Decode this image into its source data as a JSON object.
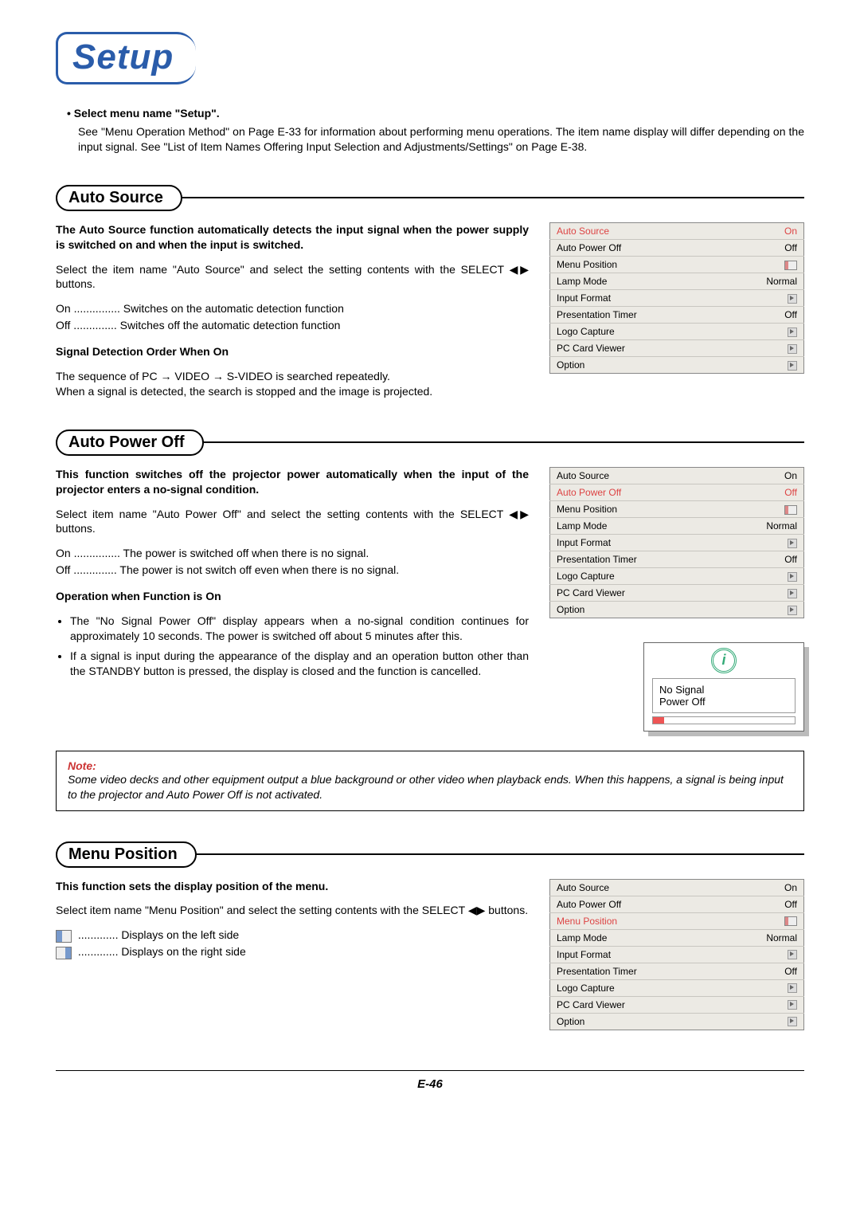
{
  "title": "Setup",
  "intro": {
    "bullet": "• Select menu name \"Setup\".",
    "text": "See \"Menu Operation Method\" on Page E-33 for information about performing menu operations. The item name display will differ depending on the input signal. See \"List of Item Names Offering Input Selection and Adjustments/Settings\" on Page E-38."
  },
  "sections": {
    "auto_source": {
      "heading": "Auto Source",
      "bold1": "The Auto Source function automatically detects the input signal when the power supply is switched on and when the input is switched.",
      "p1": "Select the item name \"Auto Source\" and select the setting contents with the SELECT ◀▶ buttons.",
      "on": "On ............... Switches on the automatic detection function",
      "off": "Off .............. Switches off the automatic detection function",
      "bold2": "Signal Detection Order When On",
      "p2": "The sequence of PC → VIDEO → S-VIDEO is searched repeatedly.",
      "p3": "When a signal is detected, the search is stopped and the image is projected."
    },
    "auto_power_off": {
      "heading": "Auto Power Off",
      "bold1": "This function switches off the projector power automatically when the input of the projector enters a no-signal condition.",
      "p1": "Select item name \"Auto Power Off\" and select the setting contents with the SELECT ◀▶ buttons.",
      "on": "On ............... The power is switched off when there is no signal.",
      "off": "Off .............. The power is not switch off even when there is no signal.",
      "bold2": "Operation when Function is On",
      "b1": "The \"No Signal Power Off\" display appears when a no-signal condition continues for approximately 10 seconds. The power is switched off about 5 minutes after this.",
      "b2": "If a signal is input during the appearance of the display and an operation button other than the STANDBY button is pressed, the display is closed and the function is cancelled.",
      "signal_line1": "No Signal",
      "signal_line2": "Power Off"
    },
    "note": {
      "title": "Note:",
      "body": "Some video decks and other equipment output a blue background or other video when playback ends. When this happens, a signal is being input to the projector and Auto Power Off is not activated."
    },
    "menu_position": {
      "heading": "Menu Position",
      "bold1": "This function sets the display position of the menu.",
      "p1": "Select item name \"Menu Position\" and select the setting contents with the SELECT ◀▶ buttons.",
      "left": " ............. Displays on the left side",
      "right": " ............. Displays on the right side"
    }
  },
  "menu_items": {
    "labels": [
      "Auto Source",
      "Auto Power Off",
      "Menu Position",
      "Lamp Mode",
      "Input Format",
      "Presentation Timer",
      "Logo Capture",
      "PC Card Viewer",
      "Option"
    ],
    "values": [
      "On",
      "Off",
      "icon-box",
      "Normal",
      "tri",
      "Off",
      "tri",
      "tri",
      "tri"
    ]
  },
  "footer": "E-46"
}
